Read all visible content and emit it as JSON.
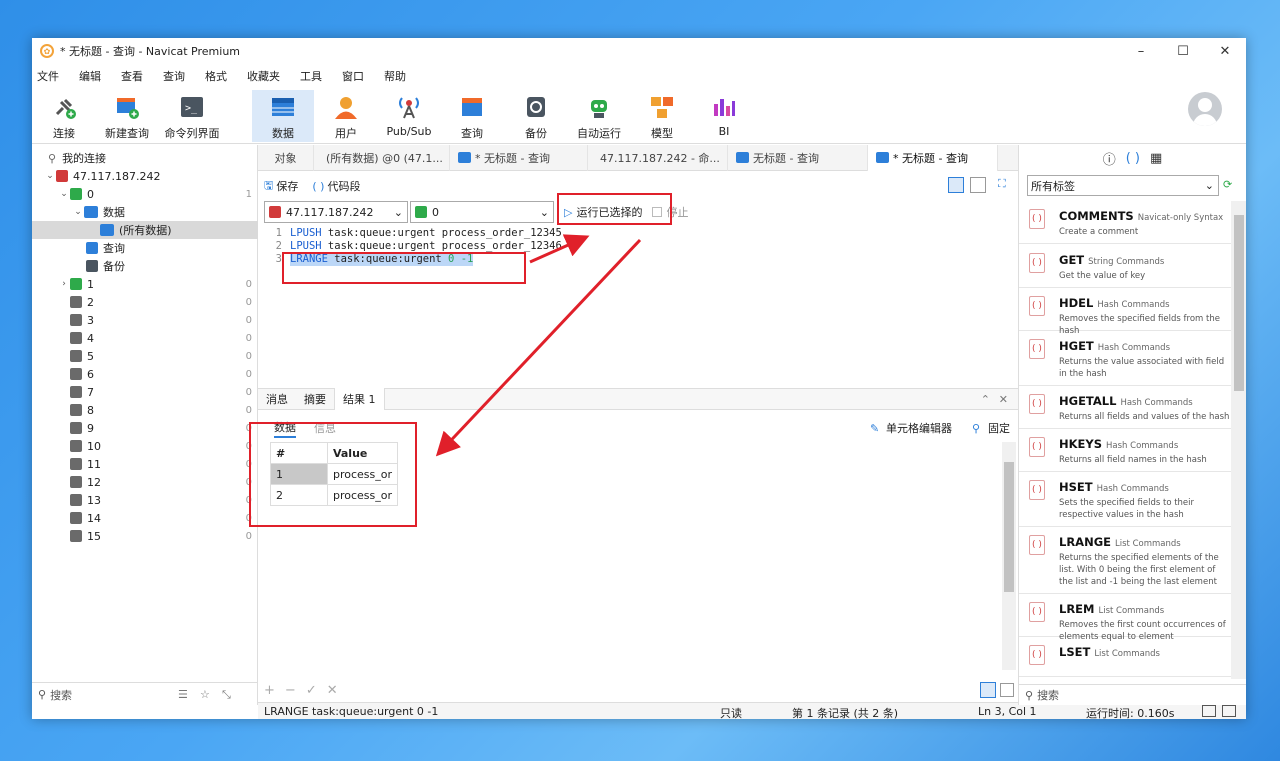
{
  "window": {
    "title": "* 无标题 - 查询 - Navicat Premium",
    "minimize": "–",
    "maximize": "☐",
    "close": "✕"
  },
  "menu": [
    "文件",
    "编辑",
    "查看",
    "查询",
    "格式",
    "收藏夹",
    "工具",
    "窗口",
    "帮助"
  ],
  "ribbon": [
    {
      "label": "连接",
      "icon": "plug-icon"
    },
    {
      "label": "新建查询",
      "icon": "new-query-icon"
    },
    {
      "label": "命令列界面",
      "icon": "console-icon"
    },
    {
      "label": "数据",
      "icon": "data-icon"
    },
    {
      "label": "用户",
      "icon": "user-icon"
    },
    {
      "label": "Pub/Sub",
      "icon": "broadcast-icon"
    },
    {
      "label": "查询",
      "icon": "query-icon"
    },
    {
      "label": "备份",
      "icon": "backup-icon"
    },
    {
      "label": "自动运行",
      "icon": "robot-icon"
    },
    {
      "label": "模型",
      "icon": "model-icon"
    },
    {
      "label": "BI",
      "icon": "bi-icon"
    }
  ],
  "left": {
    "header": "我的连接",
    "connection": "47.117.187.242",
    "db0": {
      "name": "0",
      "count": "1"
    },
    "data_folder": "数据",
    "all_data": "(所有数据)",
    "query": "查询",
    "backup": "备份",
    "dbs": [
      {
        "name": "1",
        "count": "0"
      },
      {
        "name": "2",
        "count": "0"
      },
      {
        "name": "3",
        "count": "0"
      },
      {
        "name": "4",
        "count": "0"
      },
      {
        "name": "5",
        "count": "0"
      },
      {
        "name": "6",
        "count": "0"
      },
      {
        "name": "7",
        "count": "0"
      },
      {
        "name": "8",
        "count": "0"
      },
      {
        "name": "9",
        "count": "0"
      },
      {
        "name": "10",
        "count": "0"
      },
      {
        "name": "11",
        "count": "0"
      },
      {
        "name": "12",
        "count": "0"
      },
      {
        "name": "13",
        "count": "0"
      },
      {
        "name": "14",
        "count": "0"
      },
      {
        "name": "15",
        "count": "0"
      }
    ],
    "search": "搜索"
  },
  "tabs": [
    "对象",
    "(所有数据) @0 (47.1...",
    "* 无标题 - 查询",
    "47.117.187.242 - 命...",
    "无标题 - 查询",
    "* 无标题 - 查询"
  ],
  "editor": {
    "save": "保存",
    "snippet": "代码段",
    "conn": "47.117.187.242",
    "db": "0",
    "run": "运行已选择的",
    "stop": "停止",
    "lines": [
      {
        "n": "1",
        "kw": "LPUSH",
        "rest": " task:queue:urgent process_order_12345"
      },
      {
        "n": "2",
        "kw": "LPUSH",
        "rest": " task:queue:urgent process_order_12346"
      },
      {
        "n": "3",
        "kw": "LRANGE",
        "rest": " task:queue:urgent ",
        "a": "0",
        "b": "-1"
      }
    ]
  },
  "results": {
    "tabs": [
      "消息",
      "摘要",
      "结果 1"
    ],
    "sub": [
      "数据",
      "信息"
    ],
    "cell_editor": "单元格编辑器",
    "pin": "固定",
    "columns": [
      "#",
      "Value"
    ],
    "rows": [
      [
        "1",
        "process_or"
      ],
      [
        "2",
        "process_or"
      ]
    ]
  },
  "status": {
    "sql": "LRANGE task:queue:urgent 0 -1",
    "mode": "只读",
    "records": "第 1 条记录 (共 2 条)",
    "pos": "Ln 3, Col 1",
    "time": "运行时间: 0.160s"
  },
  "right": {
    "filter": "所有标签",
    "snippets": [
      {
        "name": "COMMENTS",
        "cat": "Navicat-only Syntax",
        "desc": "Create a comment"
      },
      {
        "name": "GET",
        "cat": "String Commands",
        "desc": "Get the value of key"
      },
      {
        "name": "HDEL",
        "cat": "Hash Commands",
        "desc": "Removes the specified fields from the hash"
      },
      {
        "name": "HGET",
        "cat": "Hash Commands",
        "desc": "Returns the value associated with field in the hash"
      },
      {
        "name": "HGETALL",
        "cat": "Hash Commands",
        "desc": "Returns all fields and values of the hash"
      },
      {
        "name": "HKEYS",
        "cat": "Hash Commands",
        "desc": "Returns all field names in the hash"
      },
      {
        "name": "HSET",
        "cat": "Hash Commands",
        "desc": "Sets the specified fields to their respective values in the hash"
      },
      {
        "name": "LRANGE",
        "cat": "List Commands",
        "desc": "Returns the specified elements of the list. With 0 being the first element of the list and -1 being the last element"
      },
      {
        "name": "LREM",
        "cat": "List Commands",
        "desc": "Removes the first count occurrences of elements equal to element"
      },
      {
        "name": "LSET",
        "cat": "List Commands",
        "desc": ""
      }
    ],
    "search": "搜索"
  },
  "colors": {
    "accent": "#1a73d9",
    "annotation": "#e0202a",
    "selected": "#dbe9f9"
  }
}
